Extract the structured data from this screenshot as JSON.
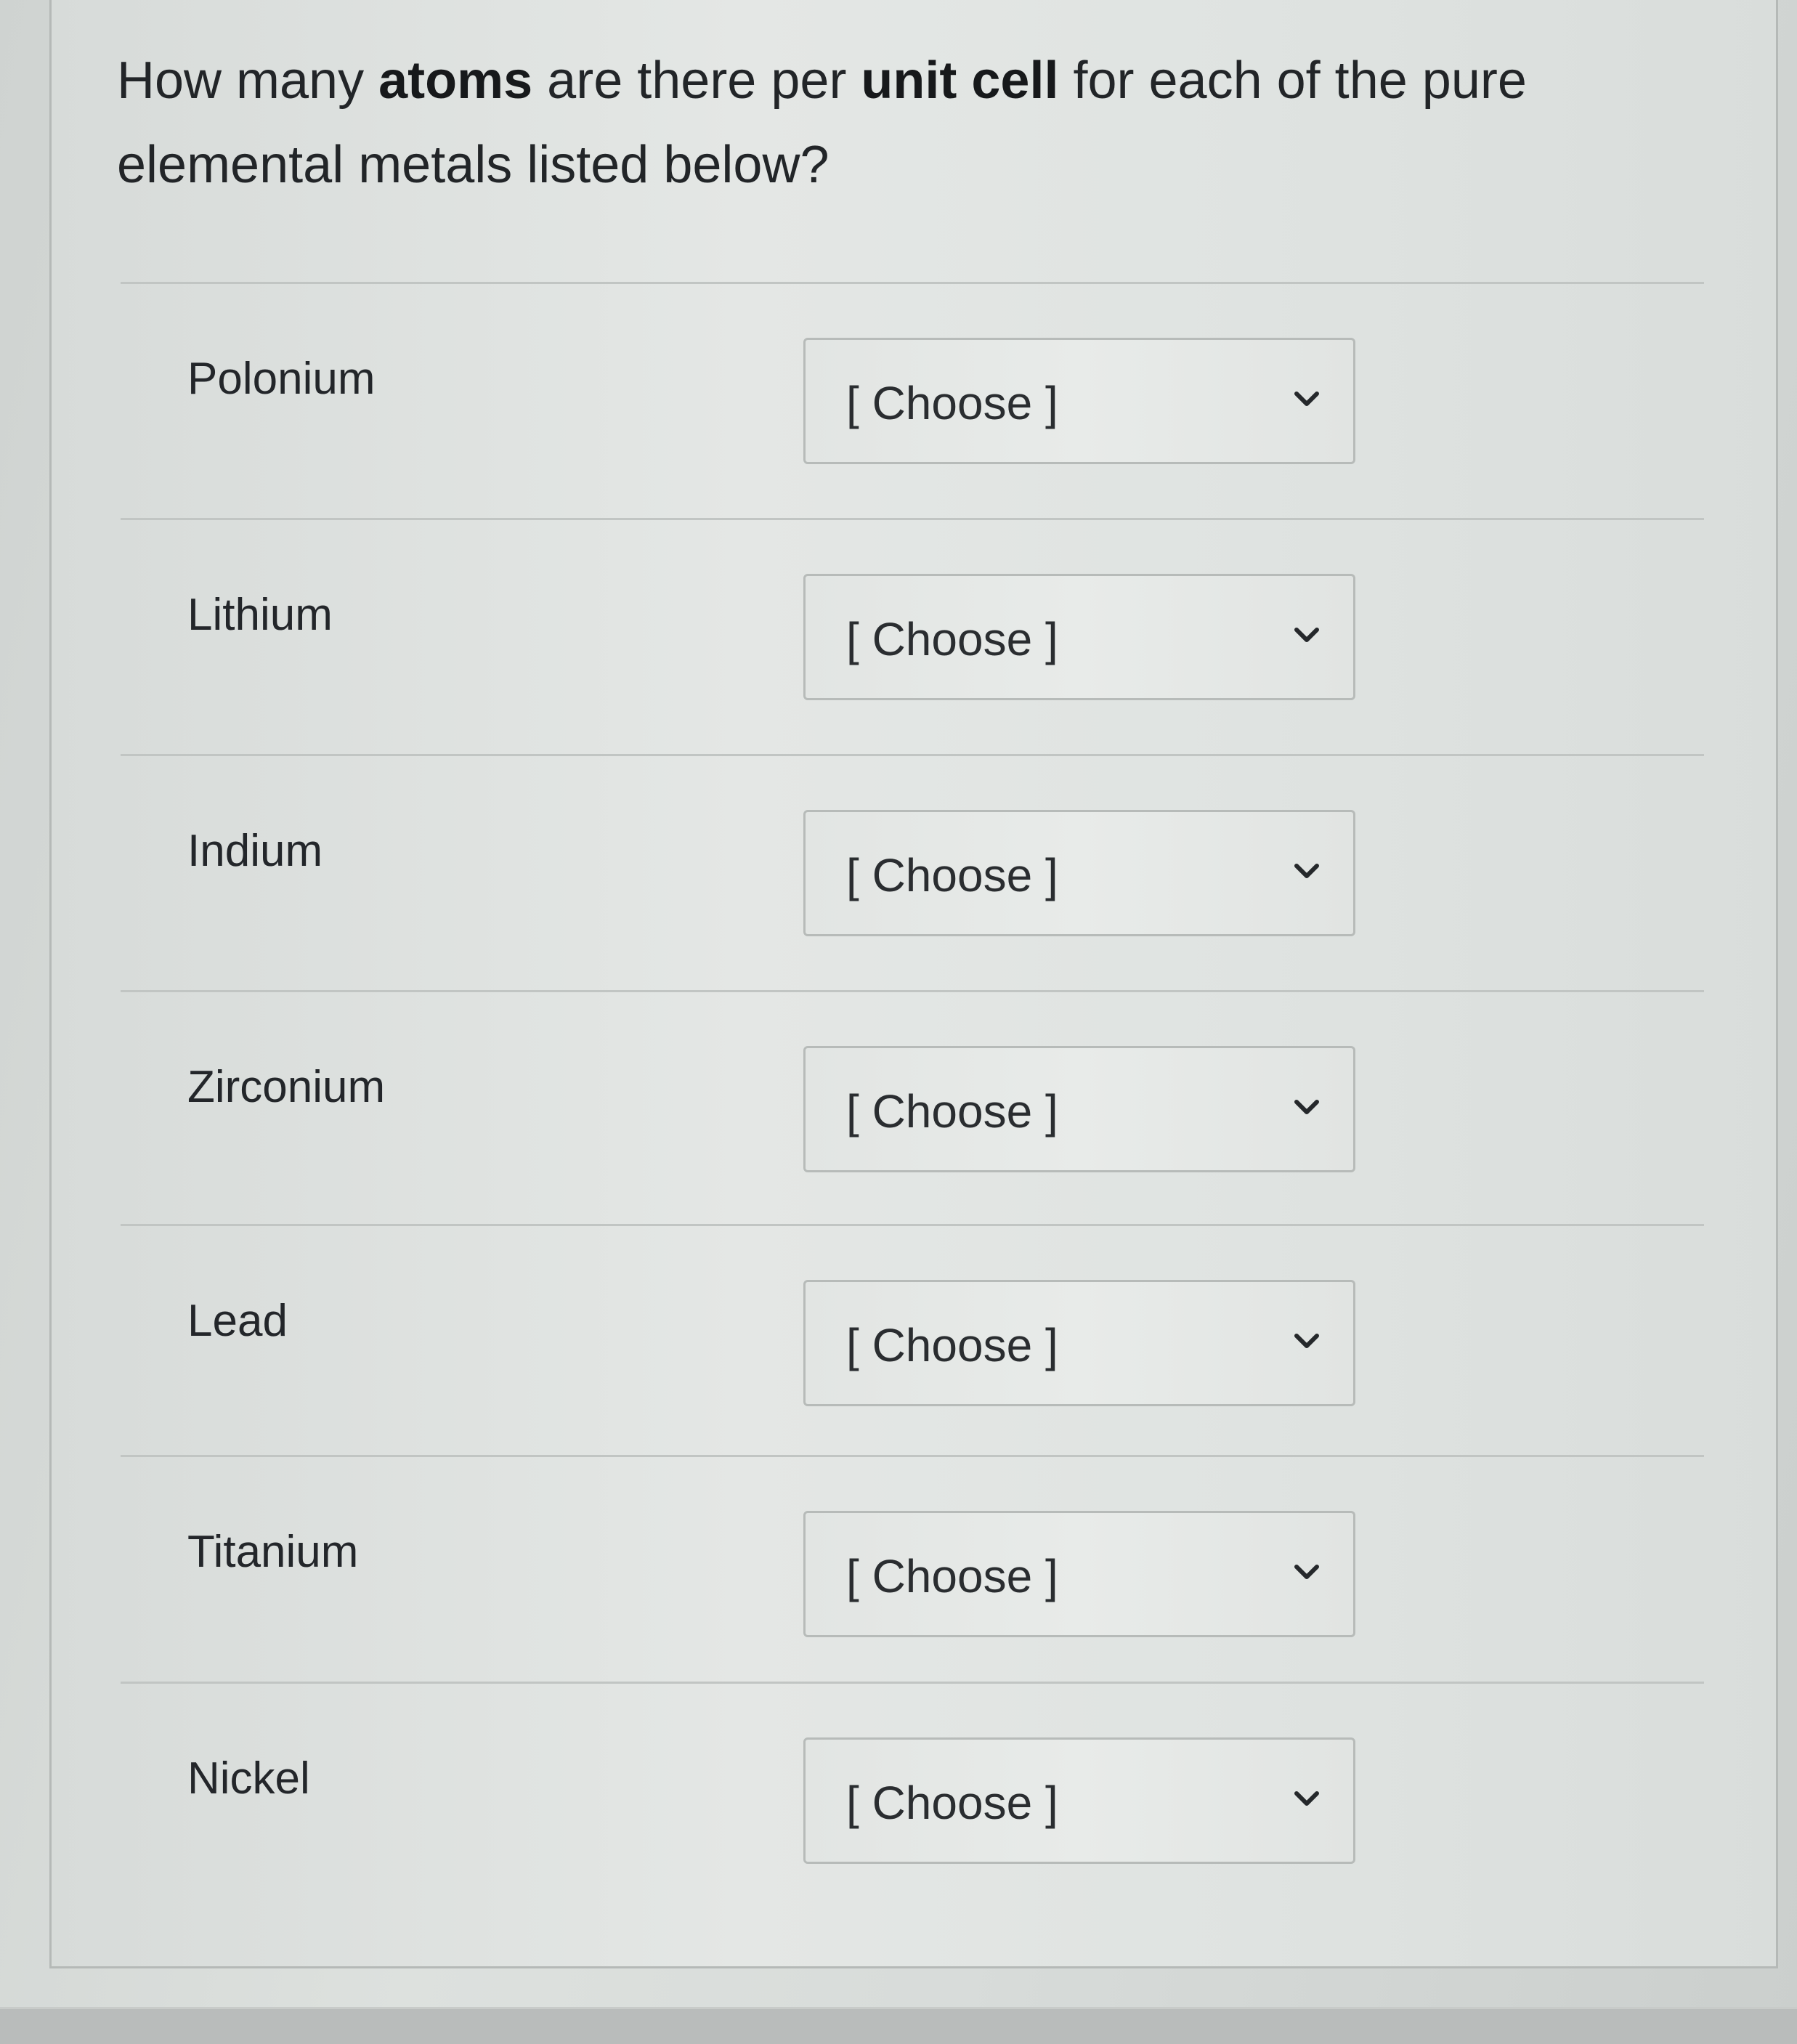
{
  "question": {
    "part1": "How many ",
    "bold1": "atoms",
    "part2": " are there per ",
    "bold2": "unit cell",
    "part3": " for each of the pure elemental metals listed below?"
  },
  "rows": [
    {
      "label": "Polonium",
      "select_value": "[ Choose ]"
    },
    {
      "label": "Lithium",
      "select_value": "[ Choose ]"
    },
    {
      "label": "Indium",
      "select_value": "[ Choose ]"
    },
    {
      "label": "Zirconium",
      "select_value": "[ Choose ]"
    },
    {
      "label": "Lead",
      "select_value": "[ Choose ]"
    },
    {
      "label": "Titanium",
      "select_value": "[ Choose ]"
    },
    {
      "label": "Nickel",
      "select_value": "[ Choose ]"
    }
  ],
  "icons": {
    "dropdown": "chevron-down-icon"
  }
}
